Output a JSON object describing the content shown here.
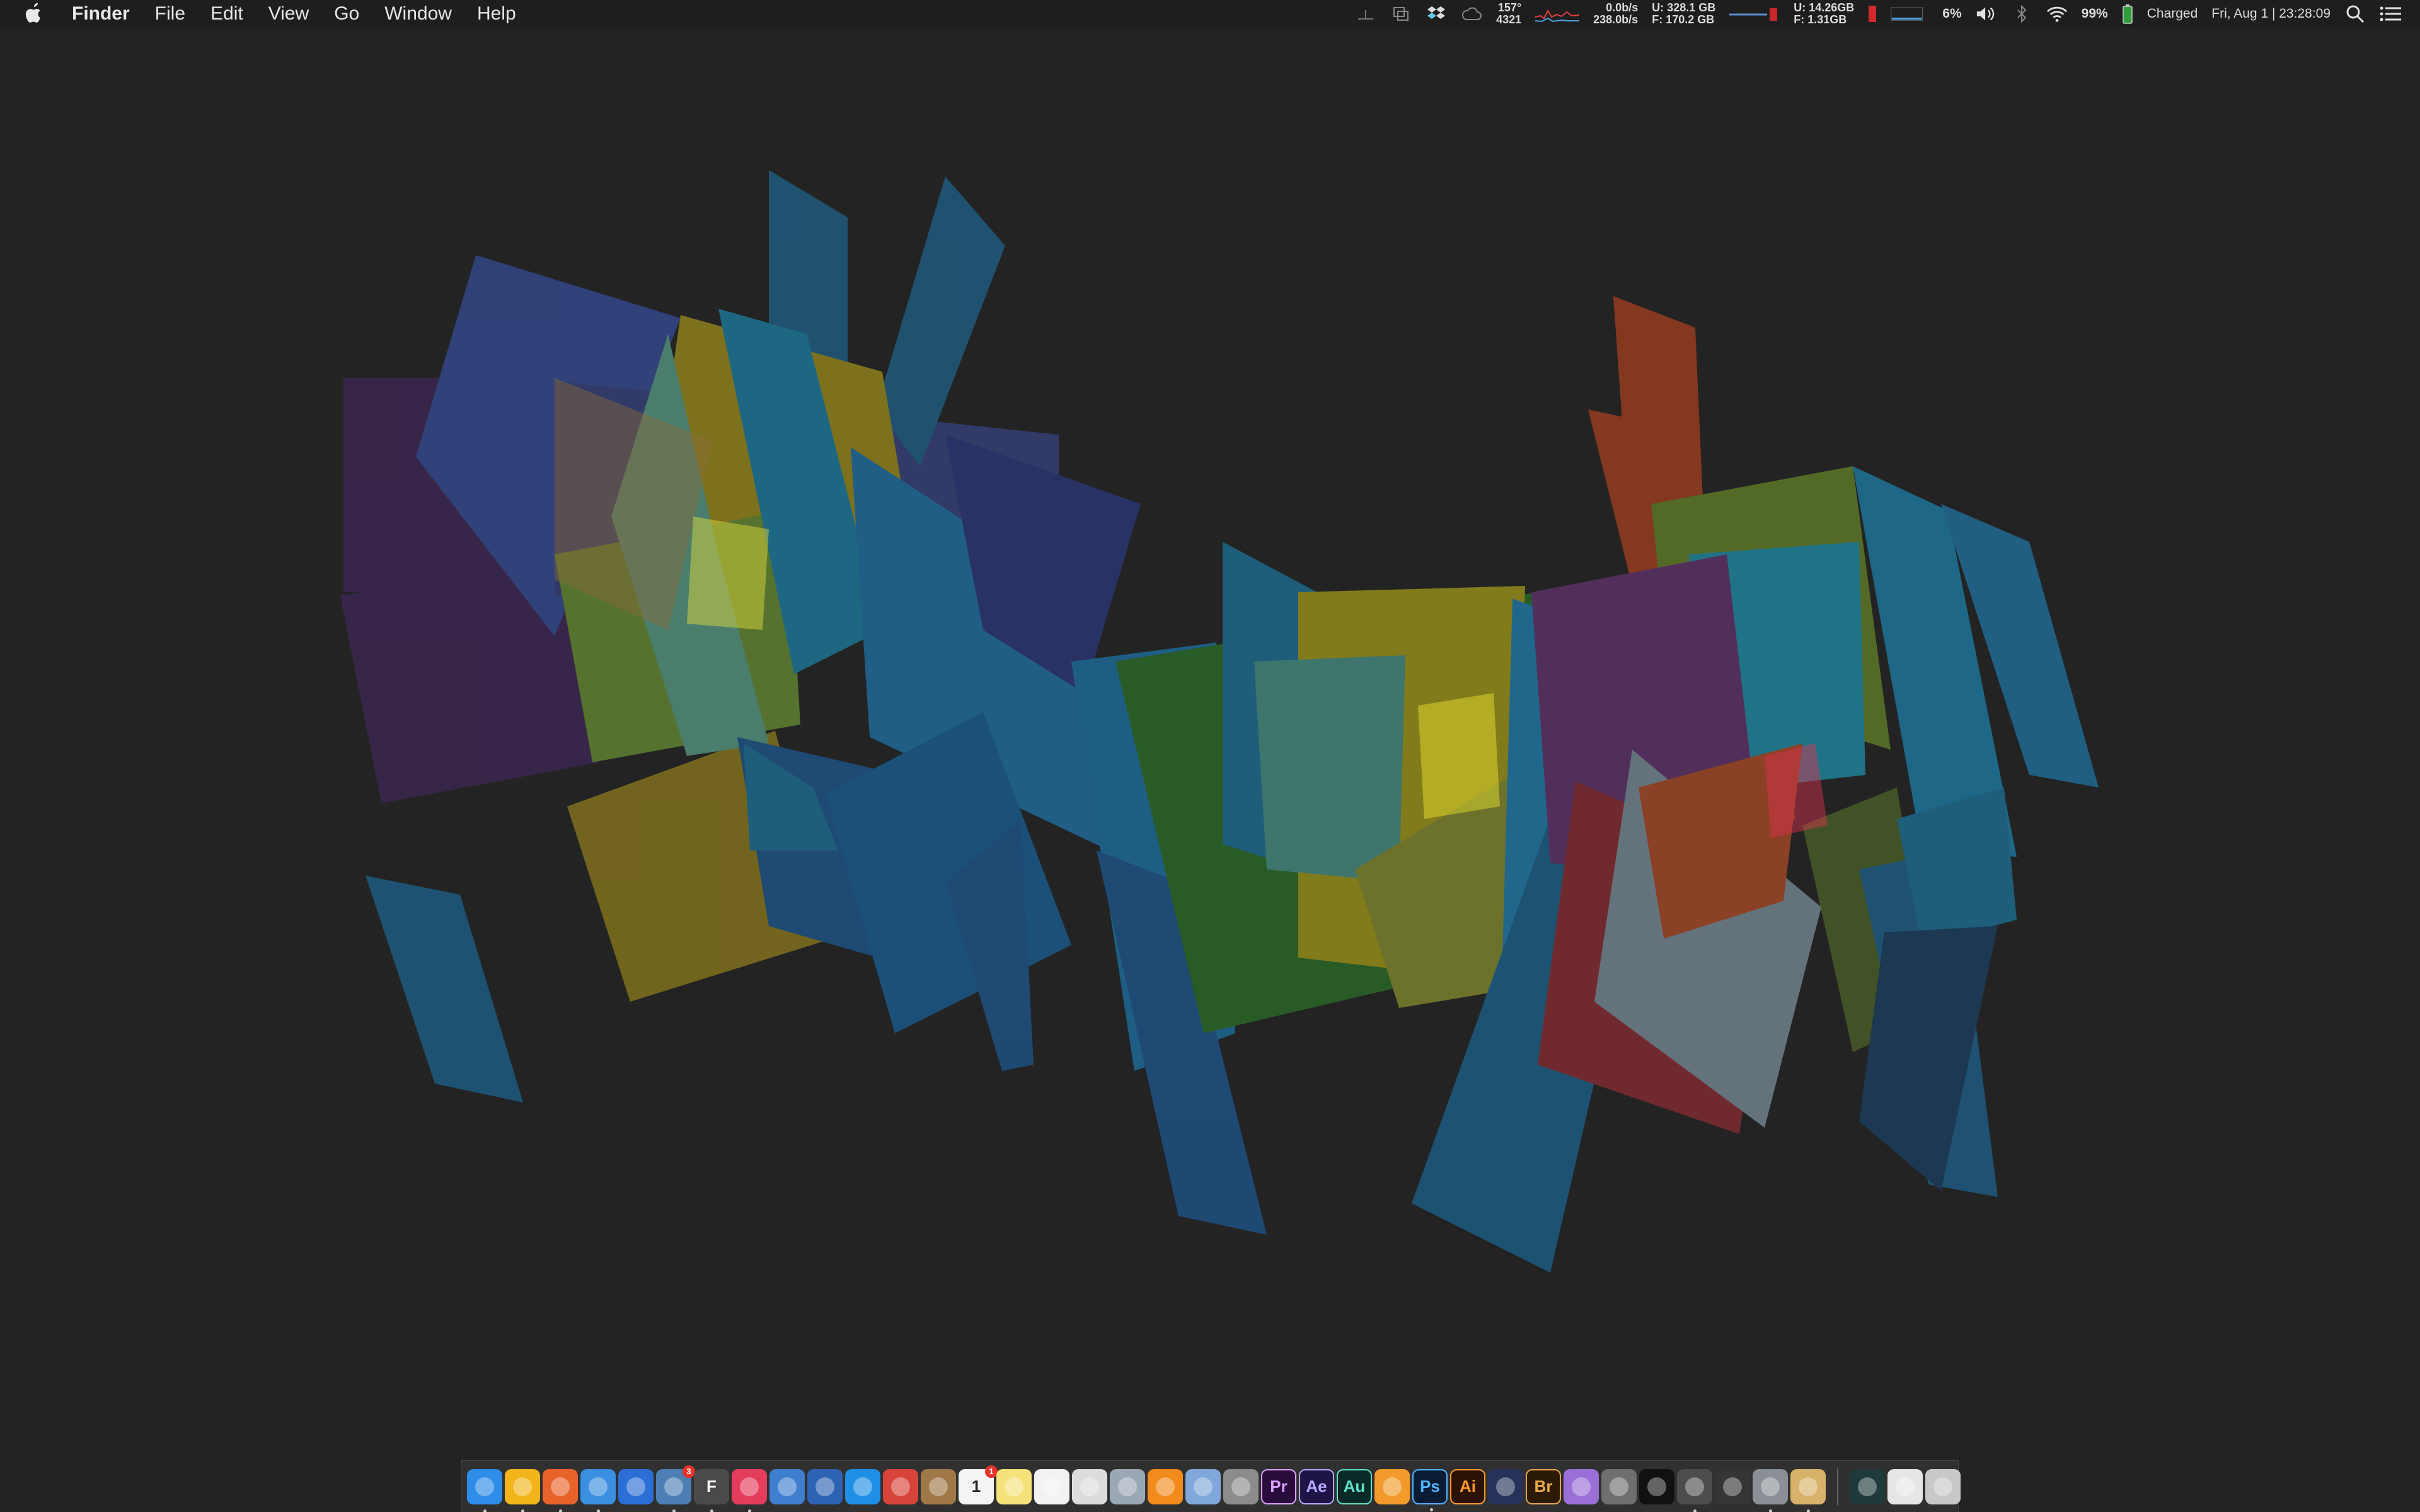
{
  "menubar": {
    "apple_icon": "apple-logo-icon",
    "app_name": "Finder",
    "menus": [
      "File",
      "Edit",
      "View",
      "Go",
      "Window",
      "Help"
    ],
    "status": {
      "temp_top": "157°",
      "temp_bottom": "4321",
      "net_up": "0.0b/s",
      "net_down": "238.0b/s",
      "disk_used": "U: 328.1 GB",
      "disk_free": "F: 170.2 GB",
      "mem_used": "U:  14.26GB",
      "mem_free": "F:   1.31GB",
      "cpu_percent": "6%",
      "battery_percent": "99%",
      "battery_status": "Charged",
      "clock": "Fri, Aug 1 | 23:28:09"
    }
  },
  "dock": {
    "apps": [
      {
        "name": "Finder",
        "icon": "finder-icon",
        "color": "#2d8de8",
        "running": true
      },
      {
        "name": "Chrome",
        "icon": "chrome-icon",
        "color": "#f2b41b",
        "running": true
      },
      {
        "name": "Firefox",
        "icon": "firefox-icon",
        "color": "#e8632a",
        "running": true
      },
      {
        "name": "Safari",
        "icon": "safari-icon",
        "color": "#3a8fe0",
        "running": true
      },
      {
        "name": "Proxyman",
        "icon": "magnifier-icon",
        "color": "#2b6fd6",
        "running": false
      },
      {
        "name": "Preview",
        "icon": "preview-icon",
        "color": "#4d7fb5",
        "running": true,
        "badge": "3"
      },
      {
        "name": "Fontlab",
        "icon": "f-icon",
        "color": "#4a4a4a",
        "label": "F",
        "running": true
      },
      {
        "name": "iTunes",
        "icon": "music-icon",
        "color": "#e43d5c",
        "running": true
      },
      {
        "name": "QuickTime",
        "icon": "quicktime-icon",
        "color": "#3f7fcf",
        "running": false
      },
      {
        "name": "Screens",
        "icon": "screens-icon",
        "color": "#2e63b3",
        "running": false
      },
      {
        "name": "TeamViewer",
        "icon": "teamviewer-icon",
        "color": "#1f8fe5",
        "running": false
      },
      {
        "name": "Presentation",
        "icon": "presentation-icon",
        "color": "#d9443a",
        "running": false
      },
      {
        "name": "Notebook",
        "icon": "notebook-icon",
        "color": "#a07848",
        "running": false
      },
      {
        "name": "Calendar",
        "icon": "calendar-icon",
        "color": "#f4f4f4",
        "label": "1",
        "running": false,
        "badge": "1"
      },
      {
        "name": "Notes",
        "icon": "notes-icon",
        "color": "#f6e27a",
        "running": false
      },
      {
        "name": "Reminders",
        "icon": "reminders-icon",
        "color": "#f2f2f2",
        "running": false
      },
      {
        "name": "Photo Viewer",
        "icon": "photo-icon",
        "color": "#dcdcdc",
        "running": false
      },
      {
        "name": "Image Capture",
        "icon": "camera-icon",
        "color": "#9aa8b6",
        "running": false
      },
      {
        "name": "iBooks",
        "icon": "book-icon",
        "color": "#f28a1c",
        "running": false
      },
      {
        "name": "Archiver",
        "icon": "archive-icon",
        "color": "#7fa7d9",
        "running": false
      },
      {
        "name": "Script Editor",
        "icon": "script-icon",
        "color": "#8c8c8c",
        "running": false
      },
      {
        "name": "Premiere",
        "icon": "premiere-icon",
        "color": "#2a0c3c",
        "label": "Pr",
        "text_color": "#d9a0ff",
        "running": false
      },
      {
        "name": "After Effects",
        "icon": "after-effects-icon",
        "color": "#1f1446",
        "label": "Ae",
        "text_color": "#b8a8ff",
        "running": false
      },
      {
        "name": "Audition",
        "icon": "audition-icon",
        "color": "#0a2a28",
        "label": "Au",
        "text_color": "#5fe0c8",
        "running": false
      },
      {
        "name": "Pixelmator",
        "icon": "pixelmator-icon",
        "color": "#f29a2c",
        "running": false
      },
      {
        "name": "Photoshop",
        "icon": "photoshop-icon",
        "color": "#0a1c33",
        "label": "Ps",
        "text_color": "#4fb3ff",
        "running": true
      },
      {
        "name": "Illustrator",
        "icon": "illustrator-icon",
        "color": "#2c1205",
        "label": "Ai",
        "text_color": "#ff9a2c",
        "running": false
      },
      {
        "name": "Histogram",
        "icon": "histogram-icon",
        "color": "#27325a",
        "running": false
      },
      {
        "name": "Bridge",
        "icon": "bridge-icon",
        "color": "#2a1a06",
        "label": "Br",
        "text_color": "#e8a84a",
        "running": false
      },
      {
        "name": "1Password",
        "icon": "password-icon",
        "color": "#9b6fd8",
        "running": false
      },
      {
        "name": "Xcode Tools",
        "icon": "tools-icon",
        "color": "#6f6f6f",
        "running": false
      },
      {
        "name": "Terminal",
        "icon": "terminal-icon",
        "color": "#111111",
        "running": false
      },
      {
        "name": "Disk Utility",
        "icon": "disk-icon",
        "color": "#4d4d4d",
        "running": true
      },
      {
        "name": "Console",
        "icon": "console-icon",
        "color": "#353535",
        "running": false
      },
      {
        "name": "System Preferences",
        "icon": "gear-icon",
        "color": "#8a8f96",
        "running": true
      },
      {
        "name": "Spotlight",
        "icon": "search-doc-icon",
        "color": "#d8b26a",
        "running": true
      }
    ],
    "stacks": [
      {
        "name": "Activity Monitor",
        "icon": "activity-monitor-icon",
        "color": "#1f3a3a"
      },
      {
        "name": "Documents",
        "icon": "document-icon",
        "color": "#e6e6e6"
      },
      {
        "name": "Trash",
        "icon": "trash-icon",
        "color": "#c8c8c8"
      }
    ]
  }
}
